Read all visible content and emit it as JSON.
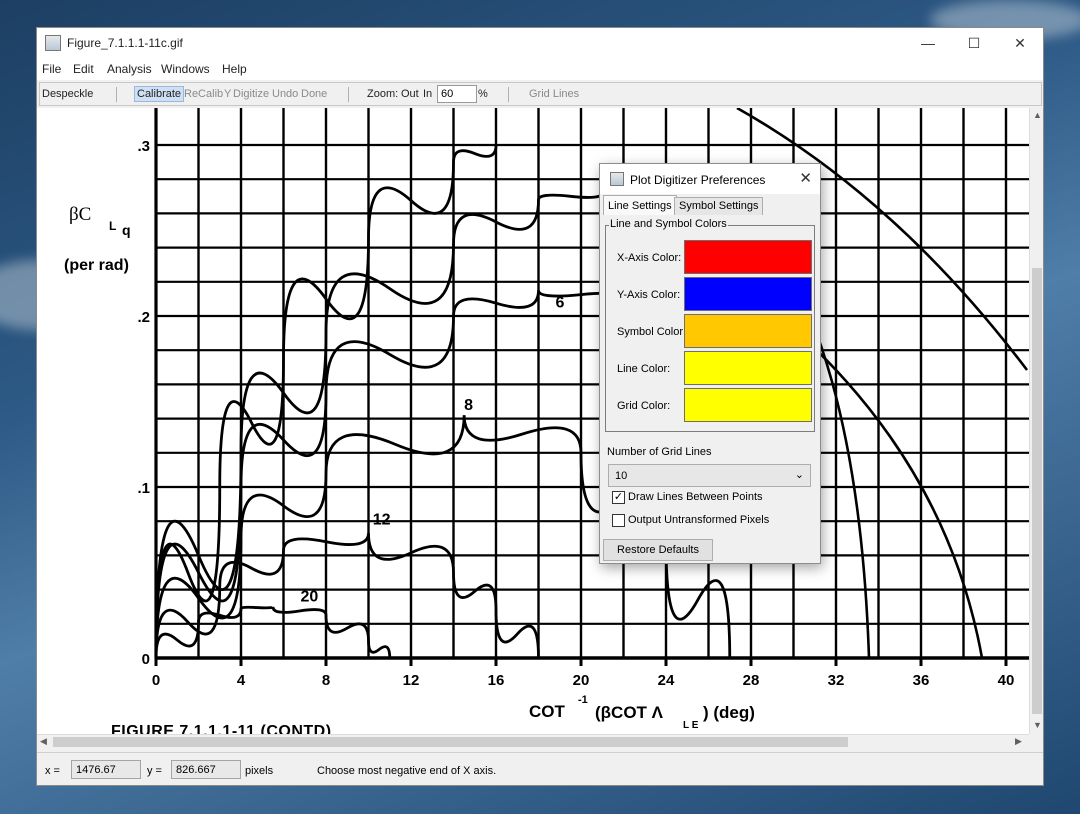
{
  "window": {
    "title": "Figure_7.1.1.1-11c.gif",
    "minimize_icon": "minimize-icon",
    "maximize_icon": "maximize-icon",
    "close_icon": "close-icon"
  },
  "menubar": [
    "File",
    "Edit",
    "Analysis",
    "Windows",
    "Help"
  ],
  "toolbar": {
    "despeckle": "Despeckle",
    "calibrate": "Calibrate",
    "recalib": "ReCalib",
    "y_label": "Y",
    "digitize": "Digitize",
    "undo": "Undo",
    "done": "Done",
    "zoom_label": "Zoom:",
    "zoom_out": "Out",
    "zoom_in": "In",
    "zoom_value": "60",
    "percent": "%",
    "grid_lines": "Grid Lines"
  },
  "figure": {
    "y_axis_label_1": "βC",
    "y_axis_label_sub": "L",
    "y_axis_label_sub2": "q",
    "y_axis_label_2": "(per rad)",
    "x_axis_label": "COT",
    "x_axis_exp": "-1",
    "x_axis_rest": "(βCOT Λ",
    "x_axis_sub": "L E",
    "x_axis_unit": ") (deg)",
    "caption": "FIGURE  7.1.1.1-11  (CONTD)",
    "y_ticks": [
      ".3",
      ".2",
      ".1",
      "0"
    ],
    "x_ticks": [
      "0",
      "4",
      "8",
      "12",
      "16",
      "20",
      "24",
      "28",
      "32",
      "36",
      "40"
    ],
    "curve_labels": [
      "6",
      "8",
      "12",
      "20"
    ]
  },
  "chart_data": {
    "type": "line",
    "title": "FIGURE 7.1.1.1-11 (CONTD)",
    "xlabel": "COT^-1 (βCOT Λ_LE) (deg)",
    "ylabel": "βC_Lq (per rad)",
    "xlim": [
      0,
      40
    ],
    "ylim": [
      0,
      0.3
    ],
    "grid": true,
    "series": [
      {
        "name": "20",
        "x": [
          0,
          2,
          4,
          5.5,
          8,
          10,
          11
        ],
        "y": [
          0,
          0.021,
          0.029,
          0.03,
          0.025,
          0.01,
          0
        ]
      },
      {
        "name": "12",
        "x": [
          0,
          3,
          6,
          10,
          14,
          16,
          18
        ],
        "y": [
          0,
          0.042,
          0.063,
          0.073,
          0.05,
          0.028,
          0
        ]
      },
      {
        "name": "8",
        "x": [
          0,
          4,
          8,
          14.5,
          20,
          24,
          27
        ],
        "y": [
          0,
          0.07,
          0.108,
          0.142,
          0.12,
          0.068,
          0
        ]
      },
      {
        "name": "6",
        "x": [
          0,
          4,
          8,
          14,
          18,
          22
        ],
        "y": [
          0,
          0.1,
          0.155,
          0.2,
          0.215,
          0.21
        ]
      },
      {
        "name": "",
        "x": [
          0,
          4,
          8,
          14,
          18,
          21
        ],
        "y": [
          0,
          0.12,
          0.19,
          0.242,
          0.268,
          0.272
        ]
      },
      {
        "name": "",
        "x": [
          0,
          3,
          6,
          10,
          14,
          16
        ],
        "y": [
          0,
          0.1,
          0.175,
          0.245,
          0.29,
          0.3
        ]
      }
    ]
  },
  "dialog": {
    "title": "Plot Digitizer Preferences",
    "tabs": [
      "Line Settings",
      "Symbol Settings"
    ],
    "color_group_title": "Line and Symbol Colors",
    "colors": [
      {
        "label": "X-Axis Color:",
        "hex": "#ff0000"
      },
      {
        "label": "Y-Axis Color:",
        "hex": "#0000ff"
      },
      {
        "label": "Symbol Color:",
        "hex": "#ffc800"
      },
      {
        "label": "Line Color:",
        "hex": "#ffff00"
      },
      {
        "label": "Grid Color:",
        "hex": "#ffff00"
      }
    ],
    "grid_count_label": "Number of Grid Lines",
    "grid_count_value": "10",
    "draw_lines_label": "Draw Lines Between Points",
    "draw_lines_checked": true,
    "output_pixels_label": "Output Untransformed Pixels",
    "output_pixels_checked": false,
    "restore_button": "Restore Defaults"
  },
  "status": {
    "x_label": "x =",
    "x_value": "1476.67",
    "y_label": "y =",
    "y_value": "826.667",
    "unit": "pixels",
    "message": "Choose most negative end of X axis."
  }
}
